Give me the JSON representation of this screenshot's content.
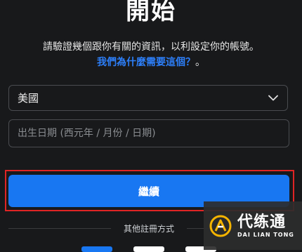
{
  "header": {
    "title": "開始"
  },
  "description": {
    "text": "請驗證幾個跟你有關的資訊，以利設定你的帳號。",
    "why_link": "我們為什麼需要這個？",
    "why_suffix": "。"
  },
  "country_select": {
    "value": "美國"
  },
  "dob": {
    "placeholder": "出生日期 (西元年 / 月份 / 日期)"
  },
  "actions": {
    "continue_label": "繼續"
  },
  "divider": {
    "label": "其他註冊方式"
  },
  "watermark": {
    "main": "代练通",
    "sub": "DAI LIAN TONG"
  },
  "colors": {
    "background": "#18191b",
    "primary_button": "#1877f2",
    "link": "#2d7ff9",
    "highlight_border": "#e02424"
  }
}
